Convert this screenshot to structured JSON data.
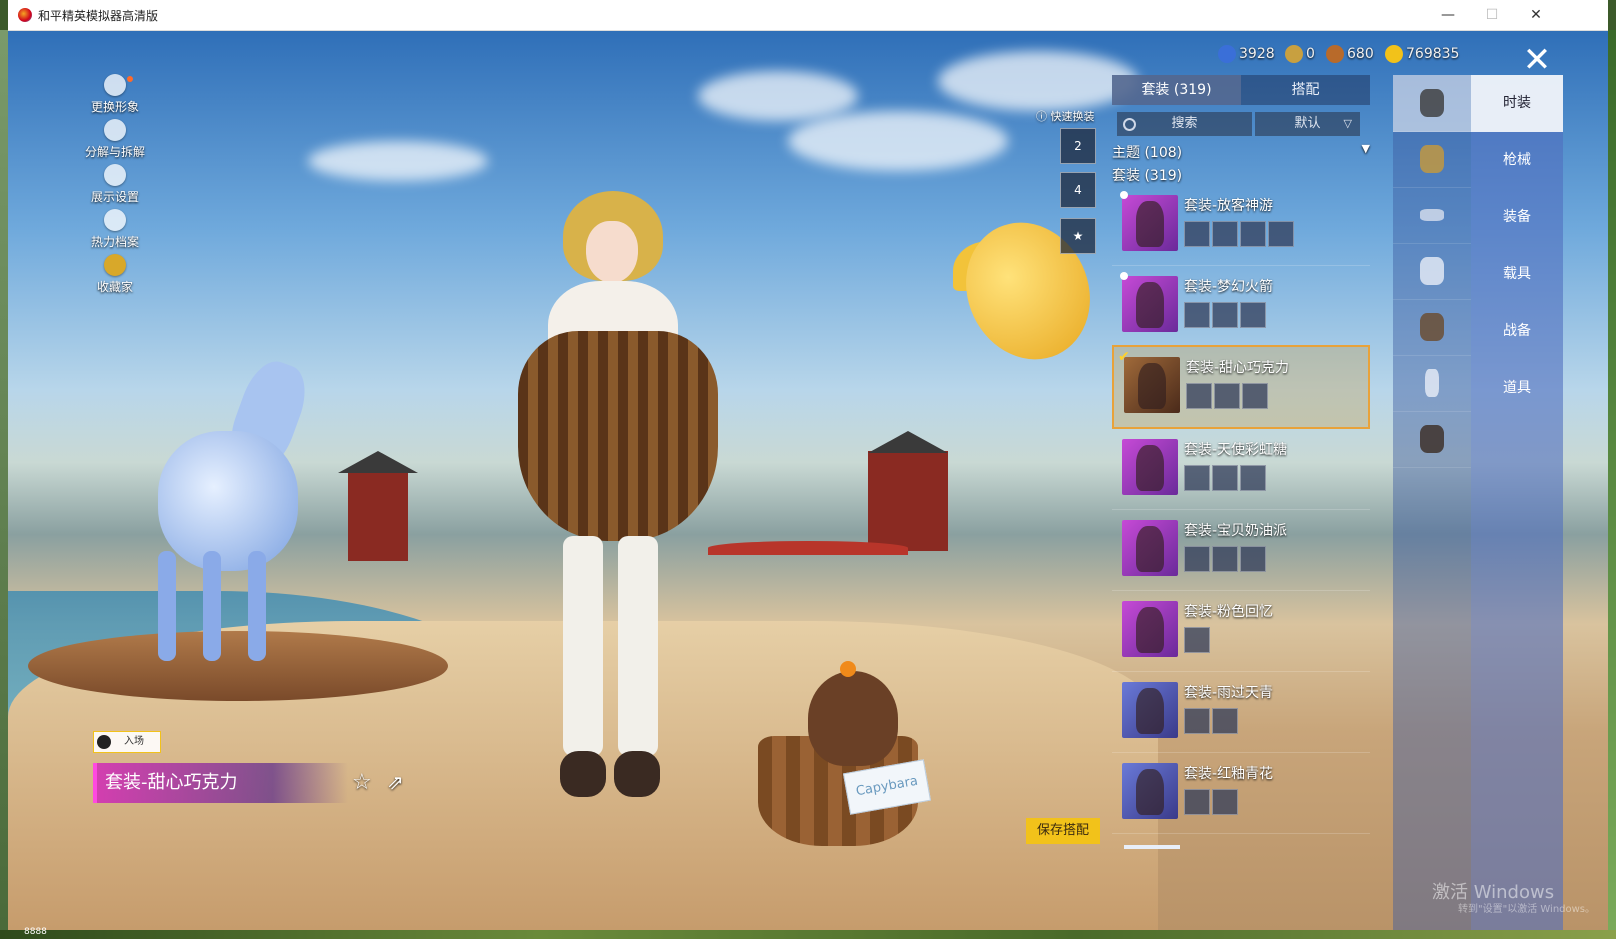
{
  "window": {
    "title": "和平精英模拟器高清版",
    "min": "—",
    "max": "☐",
    "close": "✕"
  },
  "footer": {
    "text": "8888"
  },
  "left_menu": [
    {
      "label": "更换形象",
      "icon": "avatar-icon"
    },
    {
      "label": "分解与拆解",
      "icon": "decompose-icon"
    },
    {
      "label": "展示设置",
      "icon": "eye-icon"
    },
    {
      "label": "热力档案",
      "icon": "flame-icon"
    },
    {
      "label": "收藏家",
      "icon": "collector-icon"
    }
  ],
  "currencies": [
    {
      "icon": "globe-coin-icon",
      "value": "3928",
      "color": "#3a6fd8"
    },
    {
      "icon": "a-coin-icon",
      "value": "0",
      "color": "#c8a040"
    },
    {
      "icon": "bronze-coin-icon",
      "value": "680",
      "color": "#b86a2a"
    },
    {
      "icon": "gold-coin-icon",
      "value": "769835",
      "color": "#f2c21a"
    }
  ],
  "tabs": [
    {
      "label": "套装 (319)"
    },
    {
      "label": "搭配"
    }
  ],
  "search": {
    "label": "搜索"
  },
  "sort": {
    "label": "默认",
    "arrow": "▽"
  },
  "theme": {
    "label": "主题 (108)",
    "arrow": "▼"
  },
  "subhead": "套装 (319)",
  "quick_switch": {
    "label": "快速换装",
    "buttons": [
      "2",
      "4",
      ""
    ]
  },
  "items": [
    {
      "name": "套装-放客神游",
      "minis": 4,
      "selected": false
    },
    {
      "name": "套装-梦幻火箭",
      "minis": 3,
      "selected": false
    },
    {
      "name": "套装-甜心巧克力",
      "minis": 3,
      "selected": true
    },
    {
      "name": "套装-天使彩虹糖",
      "minis": 3,
      "selected": false
    },
    {
      "name": "套装-宝贝奶油派",
      "minis": 3,
      "selected": false
    },
    {
      "name": "套装-粉色回忆",
      "minis": 1,
      "selected": false
    },
    {
      "name": "套装-雨过天青",
      "minis": 2,
      "selected": false
    },
    {
      "name": "套装-红釉青花",
      "minis": 2,
      "selected": false
    }
  ],
  "categories": [
    {
      "label": "时装",
      "active": true
    },
    {
      "label": "枪械",
      "active": false
    },
    {
      "label": "装备",
      "active": false
    },
    {
      "label": "载具",
      "active": false
    },
    {
      "label": "战备",
      "active": false
    },
    {
      "label": "道具",
      "active": false
    }
  ],
  "icon_column": [
    {
      "icon": "outfit-icon",
      "active": true
    },
    {
      "icon": "hat-icon",
      "active": false
    },
    {
      "icon": "glasses-icon",
      "active": false
    },
    {
      "icon": "mask-icon",
      "active": false
    },
    {
      "icon": "top-icon",
      "active": false
    },
    {
      "icon": "pants-icon",
      "active": false
    },
    {
      "icon": "shoes-icon",
      "active": false
    }
  ],
  "save_button": "保存搭配",
  "entry_badge": "入场",
  "outfit_title": "套装-甜心巧克力",
  "towel_text": "Capybara",
  "watermark": {
    "line1": "激活 Windows",
    "line2": "转到\"设置\"以激活 Windows。"
  }
}
